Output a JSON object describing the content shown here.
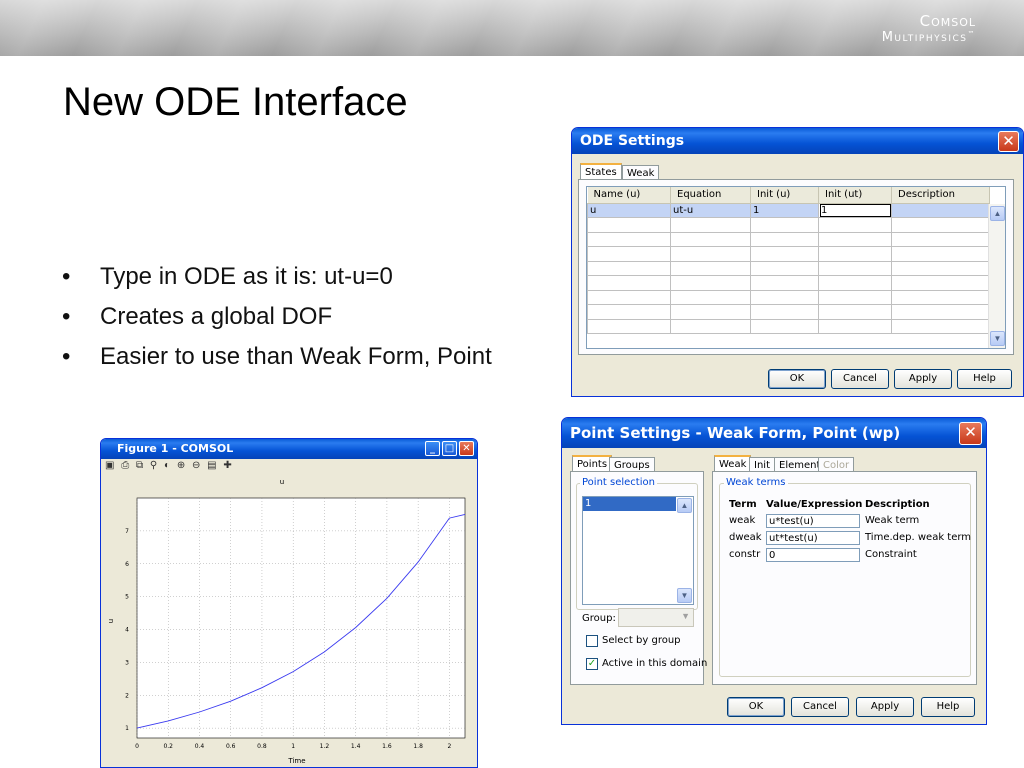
{
  "slide": {
    "title": "New ODE Interface",
    "logo_line1": "Comsol",
    "logo_line2": "Multiphysics",
    "logo_tm": "™",
    "bullets": [
      {
        "marker": "•",
        "text": "Type in ODE as it is: ut-u=0"
      },
      {
        "marker": "•",
        "text": "Creates a global DOF"
      },
      {
        "marker": "•",
        "text": "Easier to use than Weak Form, Point"
      }
    ]
  },
  "ode_dialog": {
    "title": "ODE Settings",
    "close_glyph": "✕",
    "tabs": [
      "States",
      "Weak"
    ],
    "columns": [
      "Name (u)",
      "Equation",
      "Init (u)",
      "Init (ut)",
      "Description"
    ],
    "rows": [
      [
        "u",
        "ut-u",
        "1",
        "1",
        ""
      ]
    ],
    "scroll_up": "▲",
    "scroll_down": "▼",
    "buttons": {
      "ok": "OK",
      "cancel": "Cancel",
      "apply": "Apply",
      "help": "Help"
    }
  },
  "point_dialog": {
    "title": "Point Settings - Weak Form, Point (wp)",
    "close_glyph": "✕",
    "left_tabs": [
      "Points",
      "Groups"
    ],
    "point_selection_legend": "Point selection",
    "points": [
      "1"
    ],
    "group_label": "Group:",
    "select_by_group_label": "Select by group",
    "active_in_domain_label": "Active in this domain",
    "active_in_domain_checked": true,
    "select_by_group_checked": false,
    "right_tabs": [
      "Weak",
      "Init",
      "Element",
      "Color"
    ],
    "weak_terms_legend": "Weak terms",
    "term_headers": {
      "term": "Term",
      "value": "Value/Expression",
      "description": "Description"
    },
    "terms": [
      {
        "term": "weak",
        "value": "u*test(u)",
        "description": "Weak term"
      },
      {
        "term": "dweak",
        "value": "ut*test(u)",
        "description": "Time.dep. weak term"
      },
      {
        "term": "constr",
        "value": "0",
        "description": "Constraint"
      }
    ],
    "buttons": {
      "ok": "OK",
      "cancel": "Cancel",
      "apply": "Apply",
      "help": "Help"
    }
  },
  "figure_window": {
    "title": "Figure 1 - COMSOL",
    "toolbar_glyphs": "▣ ⎙ ⧉ ⚲ ◐ ⊕ ⊖ ▤ ✚",
    "minimize": "_",
    "maximize": "□",
    "close": "✕"
  },
  "chart_data": {
    "type": "line",
    "title": "u",
    "xlabel": "Time",
    "ylabel": "u",
    "xlim": [
      0,
      2.1
    ],
    "ylim": [
      0.7,
      8.0
    ],
    "xticks": [
      "0",
      "0.2",
      "0.4",
      "0.6",
      "0.8",
      "1",
      "1.2",
      "1.4",
      "1.6",
      "1.8",
      "2"
    ],
    "yticks": [
      "1",
      "2",
      "3",
      "4",
      "5",
      "6",
      "7"
    ],
    "grid": true,
    "series": [
      {
        "color": "#3a3af0",
        "x": [
          0,
          0.2,
          0.4,
          0.6,
          0.8,
          1.0,
          1.2,
          1.4,
          1.6,
          1.8,
          2.0,
          2.1
        ],
        "y": [
          1.0,
          1.22,
          1.49,
          1.82,
          2.23,
          2.72,
          3.32,
          4.06,
          4.95,
          6.05,
          7.39,
          7.5
        ]
      }
    ]
  }
}
